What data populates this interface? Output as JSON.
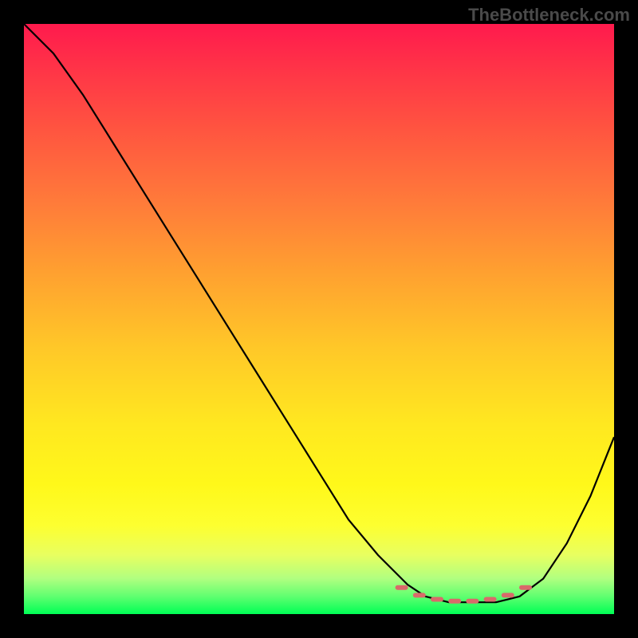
{
  "watermark": "TheBottleneck.com",
  "chart_data": {
    "type": "line",
    "title": "",
    "xlabel": "",
    "ylabel": "",
    "xlim": [
      0,
      100
    ],
    "ylim": [
      0,
      100
    ],
    "grid": false,
    "series": [
      {
        "name": "curve",
        "color": "#000000",
        "x": [
          0,
          5,
          10,
          15,
          20,
          25,
          30,
          35,
          40,
          45,
          50,
          55,
          60,
          65,
          68,
          72,
          76,
          80,
          84,
          88,
          92,
          96,
          100
        ],
        "y": [
          100,
          95,
          88,
          80,
          72,
          64,
          56,
          48,
          40,
          32,
          24,
          16,
          10,
          5,
          3,
          2,
          2,
          2,
          3,
          6,
          12,
          20,
          30
        ]
      },
      {
        "name": "highlight",
        "color": "#d96a6a",
        "style": "dotted",
        "x": [
          64,
          67,
          70,
          73,
          76,
          79,
          82,
          85
        ],
        "y": [
          4.5,
          3.2,
          2.5,
          2.2,
          2.2,
          2.5,
          3.2,
          4.5
        ]
      }
    ],
    "background_gradient": {
      "top": "#ff1a4d",
      "middle": "#ffe820",
      "bottom": "#00ff55"
    }
  }
}
